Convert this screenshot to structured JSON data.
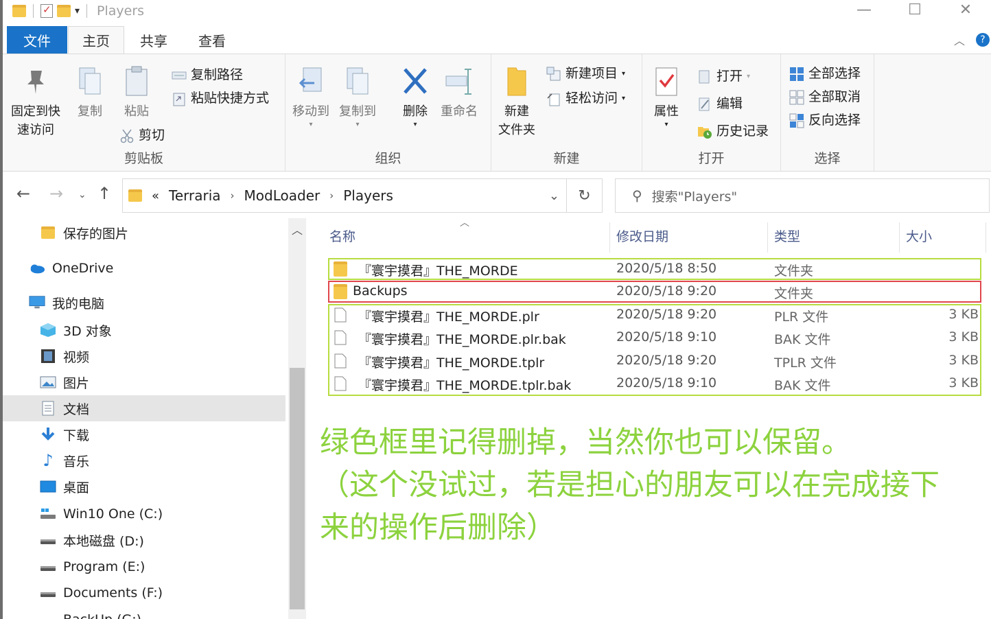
{
  "window": {
    "title": "Players"
  },
  "tabs": {
    "file": "文件",
    "home": "主页",
    "share": "共享",
    "view": "查看"
  },
  "ribbon": {
    "clipboard": {
      "label": "剪贴板",
      "pin_line1": "固定到快",
      "pin_line2": "速访问",
      "copy": "复制",
      "paste": "粘贴",
      "copy_path": "复制路径",
      "paste_shortcut": "粘贴快捷方式",
      "cut": "剪切"
    },
    "organize": {
      "label": "组织",
      "move_to": "移动到",
      "copy_to": "复制到",
      "delete": "删除",
      "rename": "重命名"
    },
    "new": {
      "label": "新建",
      "new_folder_line1": "新建",
      "new_folder_line2": "文件夹",
      "new_item": "新建项目",
      "easy_access": "轻松访问"
    },
    "open": {
      "label": "打开",
      "properties": "属性",
      "open": "打开",
      "edit": "编辑",
      "history": "历史记录"
    },
    "select": {
      "label": "选择",
      "select_all": "全部选择",
      "select_none": "全部取消",
      "invert": "反向选择"
    }
  },
  "address": {
    "prefix": "«",
    "crumbs": [
      "Terraria",
      "ModLoader",
      "Players"
    ],
    "search_placeholder": "搜索\"Players\""
  },
  "sidebar": {
    "items": [
      {
        "label": "保存的图片",
        "icon": "folder-icon"
      },
      {
        "label": "OneDrive",
        "icon": "cloud-icon"
      },
      {
        "label": "我的电脑",
        "icon": "computer-icon"
      },
      {
        "label": "3D 对象",
        "icon": "cube-icon"
      },
      {
        "label": "视频",
        "icon": "film-icon"
      },
      {
        "label": "图片",
        "icon": "picture-icon"
      },
      {
        "label": "文档",
        "icon": "document-icon"
      },
      {
        "label": "下载",
        "icon": "download-icon"
      },
      {
        "label": "音乐",
        "icon": "music-icon"
      },
      {
        "label": "桌面",
        "icon": "desktop-icon"
      },
      {
        "label": "Win10 One (C:)",
        "icon": "system-drive-icon"
      },
      {
        "label": "本地磁盘 (D:)",
        "icon": "drive-icon"
      },
      {
        "label": "Program (E:)",
        "icon": "drive-icon"
      },
      {
        "label": "Documents (F:)",
        "icon": "drive-icon"
      },
      {
        "label": "BackUp (G:)",
        "icon": "drive-icon"
      }
    ]
  },
  "columns": {
    "name": "名称",
    "date": "修改日期",
    "type": "类型",
    "size": "大小"
  },
  "files": [
    {
      "name": "『寰宇摸君』THE_MORDE",
      "date": "2020/5/18 8:50",
      "type": "文件夹",
      "size": "",
      "kind": "folder"
    },
    {
      "name": "Backups",
      "date": "2020/5/18 9:20",
      "type": "文件夹",
      "size": "",
      "kind": "folder"
    },
    {
      "name": "『寰宇摸君』THE_MORDE.plr",
      "date": "2020/5/18 9:20",
      "type": "PLR 文件",
      "size": "3 KB",
      "kind": "file"
    },
    {
      "name": "『寰宇摸君』THE_MORDE.plr.bak",
      "date": "2020/5/18 9:10",
      "type": "BAK 文件",
      "size": "3 KB",
      "kind": "file"
    },
    {
      "name": "『寰宇摸君』THE_MORDE.tplr",
      "date": "2020/5/18 9:20",
      "type": "TPLR 文件",
      "size": "3 KB",
      "kind": "file"
    },
    {
      "name": "『寰宇摸君』THE_MORDE.tplr.bak",
      "date": "2020/5/18 9:10",
      "type": "BAK 文件",
      "size": "3 KB",
      "kind": "file"
    }
  ],
  "annotation": {
    "line1": "绿色框里记得删掉，当然你也可以保留。",
    "line2": "（这个没试过，若是担心的朋友可以在完成接下",
    "line3": "来的操作后删除）"
  },
  "colors": {
    "accent": "#1a73c8",
    "green_box": "#b7dc3f",
    "red_box": "#e0474c",
    "note_text": "#8cd23e"
  }
}
